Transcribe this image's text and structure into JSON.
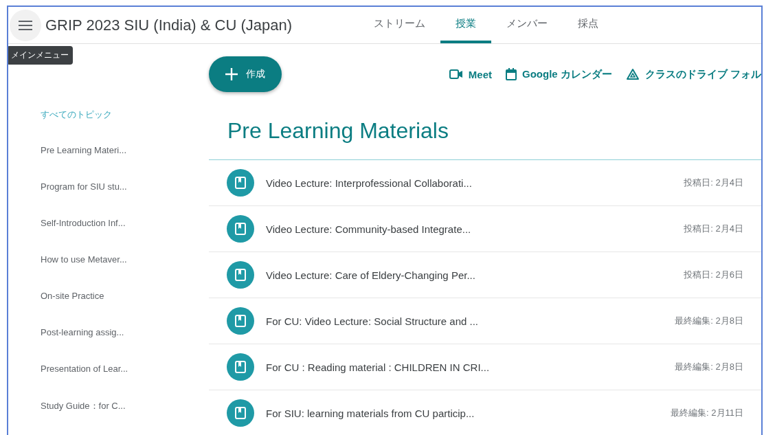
{
  "header": {
    "title": "GRIP 2023 SIU (India) & CU (Japan)",
    "tooltip": "メインメニュー"
  },
  "tabs": [
    {
      "label": "ストリーム",
      "selected": false
    },
    {
      "label": "授業",
      "selected": true
    },
    {
      "label": "メンバー",
      "selected": false
    },
    {
      "label": "採点",
      "selected": false
    }
  ],
  "create_button": {
    "label": "作成"
  },
  "links": [
    {
      "kind": "video",
      "label": "Meet"
    },
    {
      "kind": "calendar",
      "label": "Google カレンダー"
    },
    {
      "kind": "drive",
      "label": "クラスのドライブ フォル"
    }
  ],
  "sidebar": {
    "items": [
      {
        "label": "すべてのトピック",
        "selected": true
      },
      {
        "label": "Pre Learning Materi...",
        "selected": false
      },
      {
        "label": "Program for SIU stu...",
        "selected": false
      },
      {
        "label": "Self-Introduction Inf...",
        "selected": false
      },
      {
        "label": "How to use Metaver...",
        "selected": false
      },
      {
        "label": "On-site Practice",
        "selected": false
      },
      {
        "label": "Post-learning assig...",
        "selected": false
      },
      {
        "label": "Presentation of Lear...",
        "selected": false
      },
      {
        "label": "Study Guide：for C...",
        "selected": false
      }
    ]
  },
  "topic": {
    "title": "Pre Learning Materials",
    "items": [
      {
        "title": "Video Lecture: Interprofessional Collaborati...",
        "date": "投稿日: 2月4日"
      },
      {
        "title": "Video Lecture: Community-based Integrate...",
        "date": "投稿日: 2月4日"
      },
      {
        "title": "Video Lecture: Care of Eldery-Changing Per...",
        "date": "投稿日: 2月6日"
      },
      {
        "title": "For CU: Video Lecture: Social Structure and ...",
        "date": "最終編集: 2月8日"
      },
      {
        "title": "For CU : Reading material : CHILDREN IN CRI...",
        "date": "最終編集: 2月8日"
      },
      {
        "title": "For SIU: learning materials from CU particip...",
        "date": "最終編集: 2月11日"
      }
    ]
  }
}
